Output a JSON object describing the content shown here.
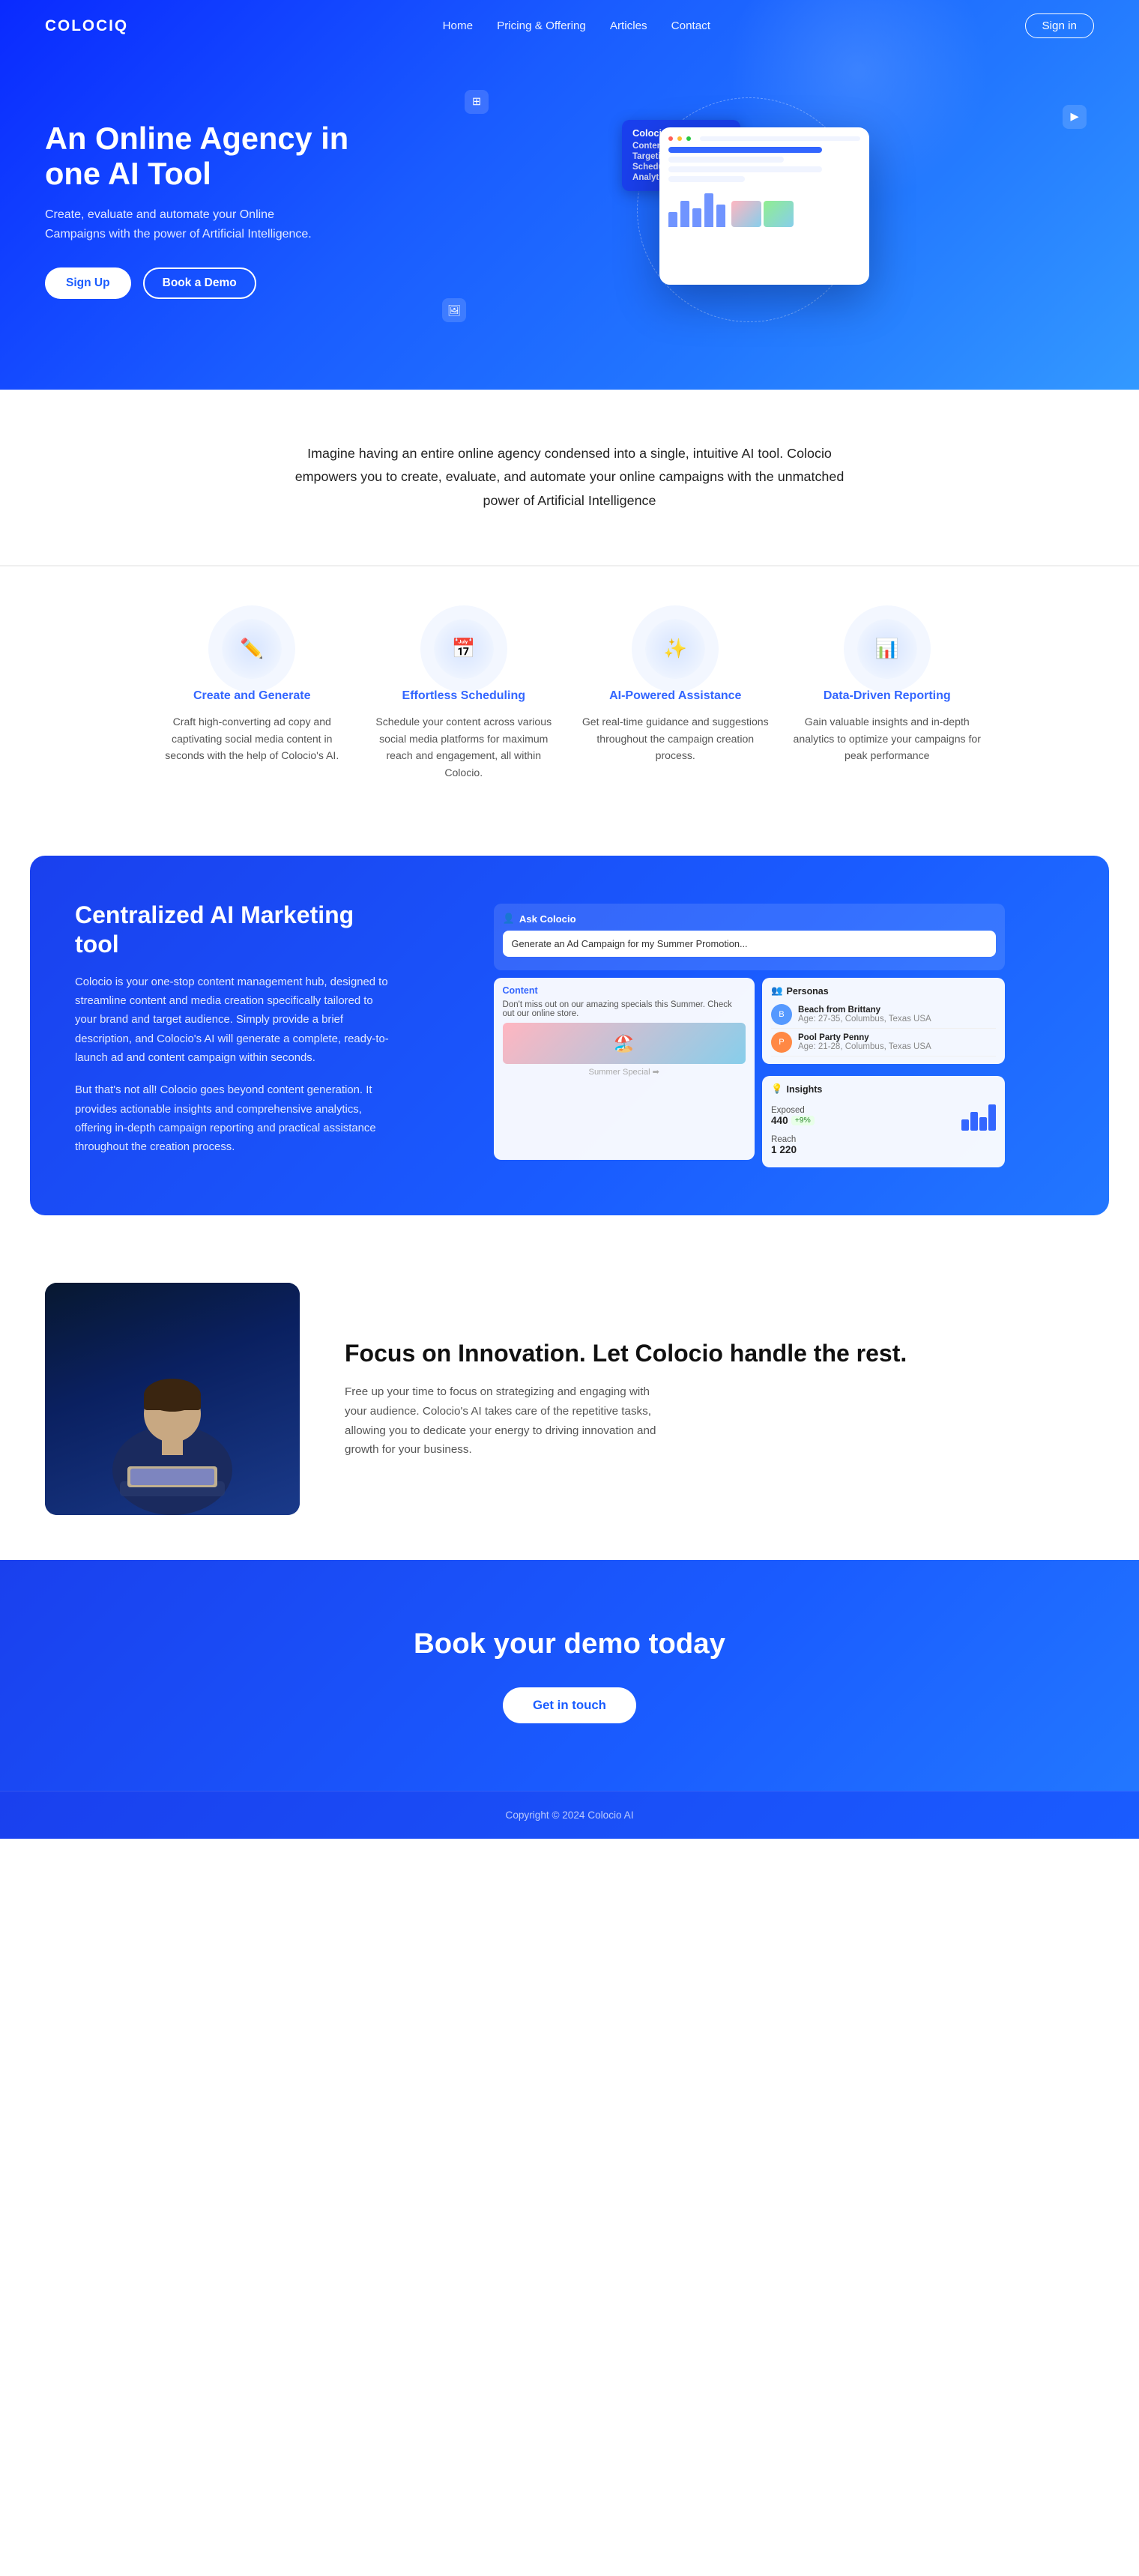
{
  "brand": {
    "name": "COLOCIO",
    "logo_text": "COLOCIQ"
  },
  "nav": {
    "links": [
      {
        "label": "Home",
        "href": "#"
      },
      {
        "label": "Pricing & Offering",
        "href": "#"
      },
      {
        "label": "Articles",
        "href": "#"
      },
      {
        "label": "Contact",
        "href": "#"
      }
    ],
    "signin_label": "Sign in"
  },
  "hero": {
    "title": "An Online Agency in one AI Tool",
    "subtitle": "Create, evaluate and automate your Online Campaigns with the power of Artificial Intelligence.",
    "btn_signup": "Sign Up",
    "btn_demo": "Book a Demo",
    "bubble": {
      "title": "Colocio recommends",
      "items": [
        "Content",
        "Targeting",
        "Scheduling",
        "Analytics"
      ]
    }
  },
  "intro": {
    "text": "Imagine having an entire online agency condensed into a single, intuitive AI tool. Colocio empowers you to create, evaluate, and automate your online campaigns with the unmatched power of Artificial Intelligence"
  },
  "features": [
    {
      "icon": "✏️",
      "title": "Create and Generate",
      "desc": "Craft high-converting ad copy and captivating social media content in seconds with the help of Colocio's AI."
    },
    {
      "icon": "📅",
      "title": "Effortless Scheduling",
      "desc": "Schedule your content across various social media platforms for maximum reach and engagement, all within Colocio."
    },
    {
      "icon": "✨",
      "title": "AI-Powered Assistance",
      "desc": "Get real-time guidance and suggestions throughout the campaign creation process."
    },
    {
      "icon": "📊",
      "title": "Data-Driven Reporting",
      "desc": "Gain valuable insights and in-depth analytics to optimize your campaigns for peak performance"
    }
  ],
  "centralized": {
    "title": "Centralized AI Marketing tool",
    "desc1": "Colocio is your one-stop content management hub, designed to streamline content and media creation specifically tailored to your brand and target audience. Simply provide a brief description, and Colocio's AI will generate a complete, ready-to-launch ad and content campaign within seconds.",
    "desc2": "But that's not all! Colocio goes beyond content generation. It provides actionable insights and comprehensive analytics, offering in-depth campaign reporting and practical assistance throughout the creation process.",
    "ask_label": "Ask Colocio",
    "prompt_text": "Generate an Ad Campaign for my Summer Promotion...",
    "content_label": "Content",
    "personas_label": "Personas",
    "insights_label": "Insights",
    "persona1_name": "Beach from Brittany",
    "persona1_detail": "Age: 27-35, Columbus, Texas USA",
    "persona2_name": "Pool Party Penny",
    "persona2_detail": "Age: 21-28, Columbus, Texas USA",
    "exposed_label": "Exposed",
    "exposed_value": "440",
    "reach_label": "Reach",
    "reach_value": "1 220",
    "badge_label": "+9%"
  },
  "focus": {
    "title": "Focus on Innovation. Let Colocio handle the rest.",
    "desc": "Free up your time to focus on strategizing and engaging with your audience. Colocio's AI takes care of the repetitive tasks, allowing you to dedicate your energy to driving innovation and growth for your business."
  },
  "cta": {
    "title": "Book your demo today",
    "btn_label": "Get in touch"
  },
  "footer": {
    "copy": "Copyright © 2024 Colocio AI"
  }
}
